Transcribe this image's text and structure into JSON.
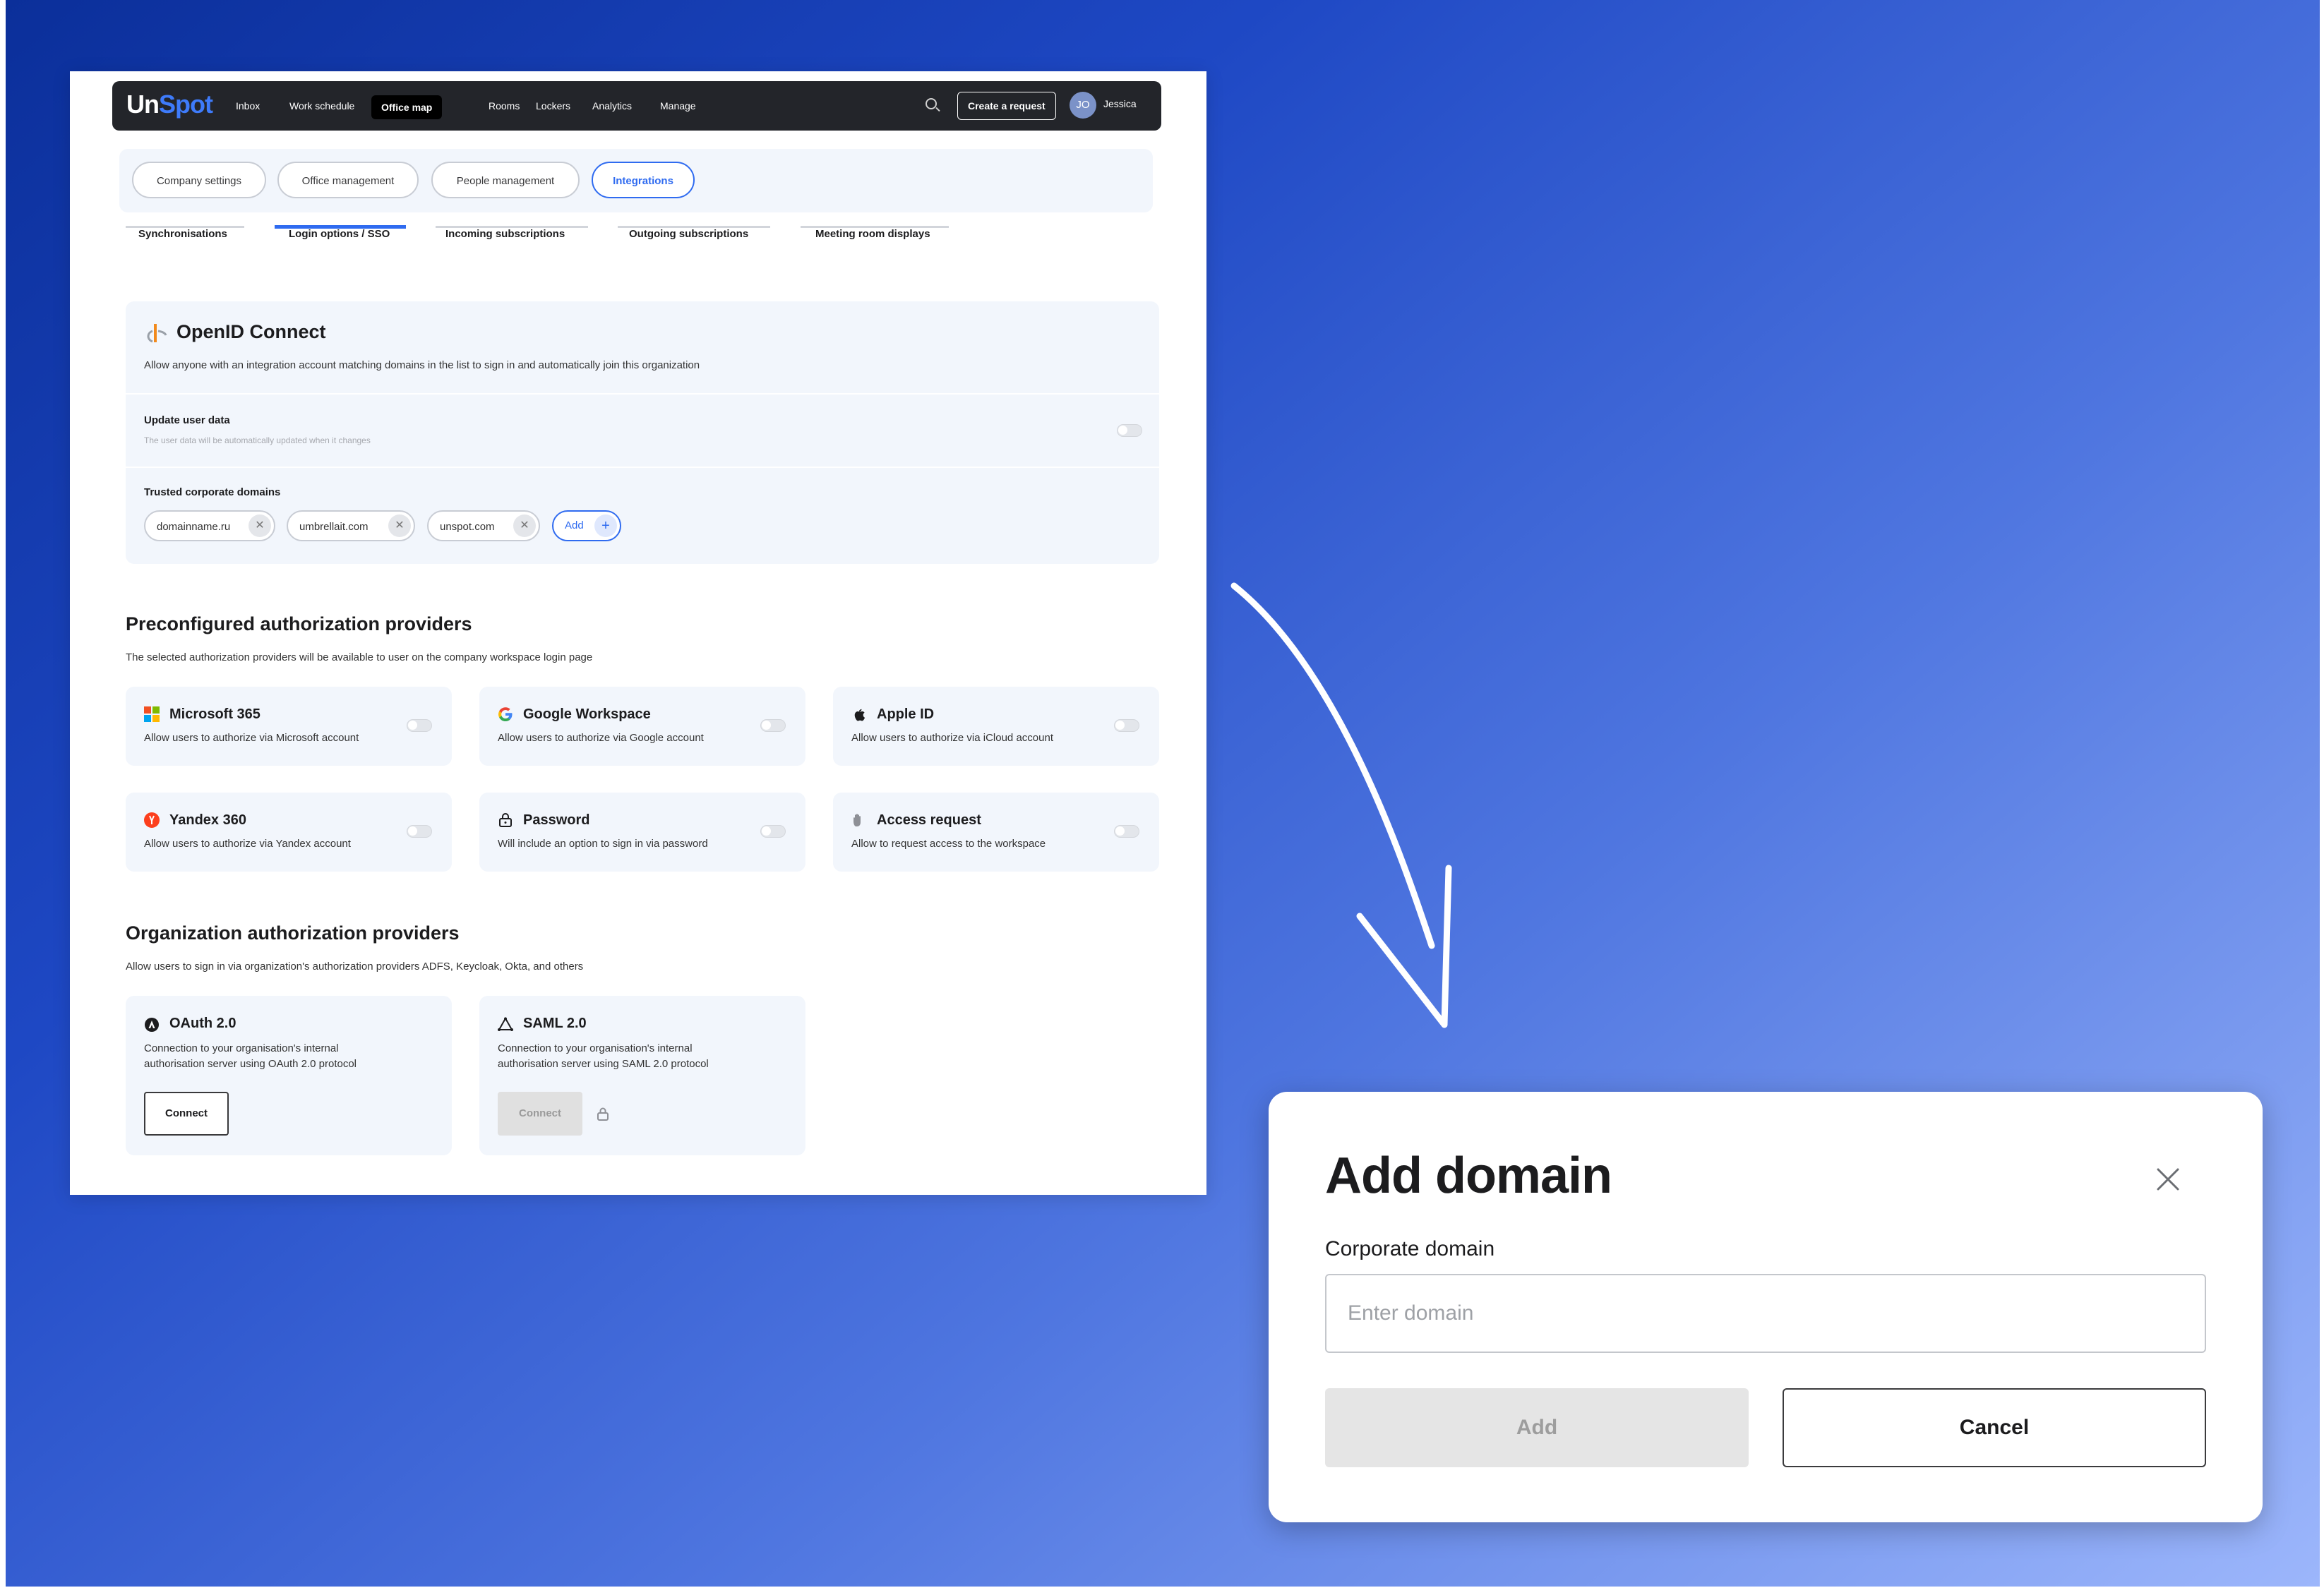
{
  "app": {
    "logo": {
      "part1": "Un",
      "part2": "Spot"
    },
    "nav": [
      "Inbox",
      "Work schedule",
      "Office map",
      "Rooms",
      "Lockers",
      "Analytics",
      "Manage"
    ],
    "active_nav": "Office map",
    "create_request": "Create a request",
    "user": {
      "initials": "JO",
      "name": "Jessica"
    }
  },
  "settings_tabs": [
    "Company settings",
    "Office management",
    "People management",
    "Integrations"
  ],
  "active_settings_tab": "Integrations",
  "subtabs": [
    "Synchronisations",
    "Login options / SSO",
    "Incoming subscriptions",
    "Outgoing subscriptions",
    "Meeting room displays"
  ],
  "active_subtab": "Login options / SSO",
  "openid": {
    "title": "OpenID Connect",
    "description": "Allow anyone with an integration account matching domains in the list to sign in and automatically join this organization",
    "update_title": "Update user data",
    "update_sub": "The user data will be automatically updated when it changes",
    "update_enabled": false,
    "domains_title": "Trusted corporate domains",
    "domains": [
      "domainname.ru",
      "umbrellait.com",
      "unspot.com"
    ],
    "add_label": "Add"
  },
  "preconfigured": {
    "title": "Preconfigured authorization providers",
    "description": "The selected authorization providers will be available to user on the company workspace login page",
    "providers": [
      {
        "name": "Microsoft 365",
        "desc": "Allow users to authorize via Microsoft account",
        "icon": "microsoft-icon",
        "enabled": false
      },
      {
        "name": "Google Workspace",
        "desc": "Allow users to authorize via Google account",
        "icon": "google-icon",
        "enabled": false
      },
      {
        "name": "Apple ID",
        "desc": "Allow users to authorize via iCloud account",
        "icon": "apple-icon",
        "enabled": false
      },
      {
        "name": "Yandex 360",
        "desc": "Allow users to authorize via Yandex account",
        "icon": "yandex-icon",
        "enabled": false
      },
      {
        "name": "Password",
        "desc": "Will include an option to sign in via password",
        "icon": "lock-icon",
        "enabled": false
      },
      {
        "name": "Access request",
        "desc": "Allow to request access to the workspace",
        "icon": "hand-icon",
        "enabled": false
      }
    ]
  },
  "organization": {
    "title": "Organization authorization providers",
    "description": "Allow users to sign in via organization's authorization providers ADFS, Keycloak, Okta, and others",
    "providers": [
      {
        "name": "OAuth 2.0",
        "desc": "Connection to your organisation's internal authorisation server using OAuth 2.0 protocol",
        "button": "Connect",
        "icon": "oauth-icon"
      },
      {
        "name": "SAML 2.0",
        "desc": "Connection to your organisation's internal authorisation server using SAML 2.0 protocol",
        "button": "Connect",
        "icon": "saml-icon"
      }
    ]
  },
  "modal": {
    "title": "Add domain",
    "field_label": "Corporate domain",
    "placeholder": "Enter domain",
    "value": "",
    "add_label": "Add",
    "cancel_label": "Cancel"
  },
  "colors": {
    "accent": "#2f6bf0",
    "topbar": "#23252a",
    "card": "#f2f6fc"
  }
}
